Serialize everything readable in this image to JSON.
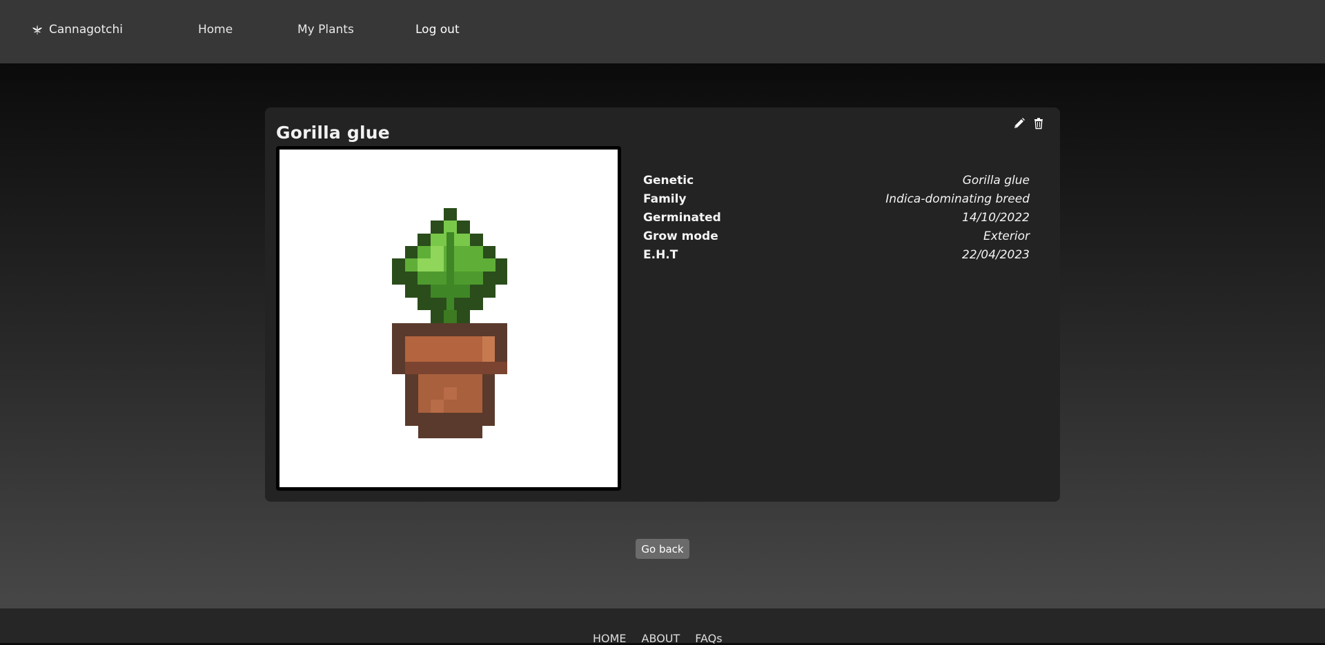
{
  "brand": {
    "name": "Cannagotchi",
    "icon": "cannabis-leaf-icon"
  },
  "nav": {
    "home": "Home",
    "my_plants": "My Plants",
    "logout": "Log out"
  },
  "plant": {
    "title": "Gorilla glue",
    "image_alt": "Pixel art potted cannabis plant",
    "details": [
      {
        "label": "Genetic",
        "value": "Gorilla glue"
      },
      {
        "label": "Family",
        "value": "Indica-dominating breed"
      },
      {
        "label": "Germinated",
        "value": "14/10/2022"
      },
      {
        "label": "Grow mode",
        "value": "Exterior"
      },
      {
        "label": "E.H.T",
        "value": "22/04/2023"
      }
    ],
    "actions": {
      "edit_icon": "pencil-icon",
      "delete_icon": "trash-icon"
    }
  },
  "go_back": "Go back",
  "footer": {
    "links": [
      "HOME",
      "ABOUT",
      "FAQs"
    ]
  },
  "colors": {
    "nav_bg": "#373737",
    "card_bg": "#232323",
    "button_bg": "#6b6b6b"
  }
}
